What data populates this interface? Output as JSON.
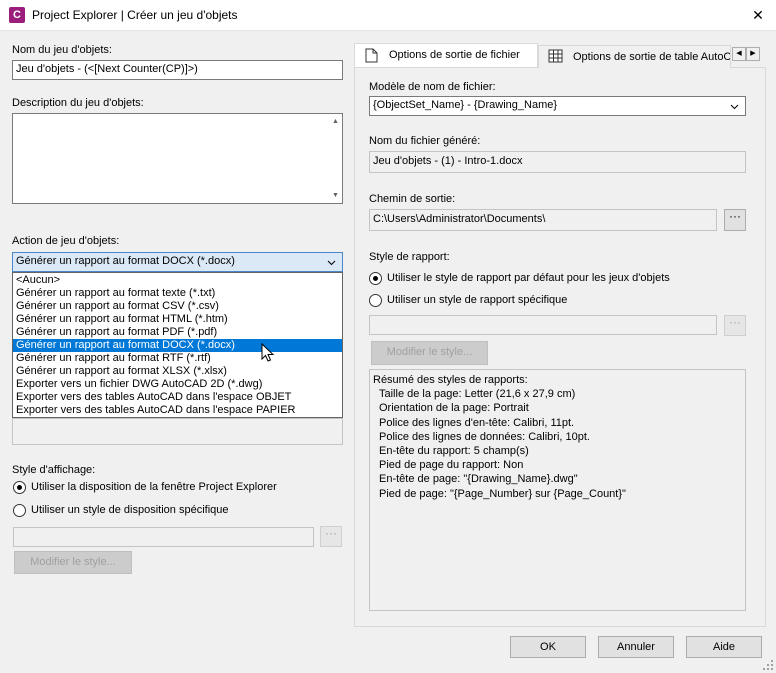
{
  "window": {
    "title": "Project Explorer | Créer un jeu d'objets",
    "icon_letter": "C",
    "close_symbol": "✕"
  },
  "left": {
    "name_label": "Nom du jeu d'objets:",
    "name_value": "Jeu d'objets - (<[Next Counter(CP)]>)",
    "description_label": "Description du jeu d'objets:",
    "description_value": "",
    "action_label": "Action de jeu d'objets:",
    "action_selected": "Générer un rapport au format DOCX (*.docx)",
    "action_options": [
      "<Aucun>",
      "Générer un rapport au format texte (*.txt)",
      "Générer un rapport au format CSV (*.csv)",
      "Générer un rapport au format HTML (*.htm)",
      "Générer un rapport au format PDF (*.pdf)",
      "Générer un rapport au format DOCX (*.docx)",
      "Générer un rapport au format RTF (*.rtf)",
      "Générer un rapport au format XLSX (*.xlsx)",
      "Exporter vers un fichier DWG AutoCAD 2D (*.dwg)",
      "Exporter vers des tables AutoCAD dans l'espace OBJET",
      "Exporter vers des tables AutoCAD dans l'espace PAPIER"
    ],
    "display_style_label": "Style d'affichage:",
    "display_option_1": "Utiliser la disposition de la fenêtre Project Explorer",
    "display_option_2": "Utiliser un style de disposition spécifique",
    "browse_label": "···",
    "modify_style_label": "Modifier le style..."
  },
  "right": {
    "tabs": [
      {
        "label": "Options de sortie de fichier"
      },
      {
        "label": "Options de sortie de table AutoCAD"
      }
    ],
    "filename_model_label": "Modèle de nom de fichier:",
    "filename_model_value": "{ObjectSet_Name} - {Drawing_Name}",
    "generated_name_label": "Nom du fichier généré:",
    "generated_name_value": "Jeu d'objets - (1) - Intro-1.docx",
    "output_path_label": "Chemin de sortie:",
    "output_path_value": "C:\\Users\\Administrator\\Documents\\",
    "browse_label": "···",
    "report_style_label": "Style de rapport:",
    "report_option_1": "Utiliser le style de rapport par défaut pour les jeux d'objets",
    "report_option_2": "Utiliser un style de rapport spécifique",
    "modify_style_label": "Modifier le style...",
    "summary_title": "Résumé des styles de rapports:",
    "summary_lines": [
      "Taille de la page: Letter (21,6 x 27,9 cm)",
      "Orientation de la page: Portrait",
      "Police des lignes d'en-tête: Calibri, 11pt.",
      "Police des lignes de données: Calibri, 10pt.",
      "En-tête du rapport: 5 champ(s)",
      "Pied de page du rapport: Non",
      "En-tête de page: \"{Drawing_Name}.dwg\"",
      "Pied de page: \"{Page_Number} sur {Page_Count}\""
    ]
  },
  "buttons": {
    "ok": "OK",
    "cancel": "Annuler",
    "help": "Aide"
  },
  "colors": {
    "selection": "#0078d7",
    "combo_open": "#dbe8f6",
    "app_icon": "#9b1e7d"
  }
}
